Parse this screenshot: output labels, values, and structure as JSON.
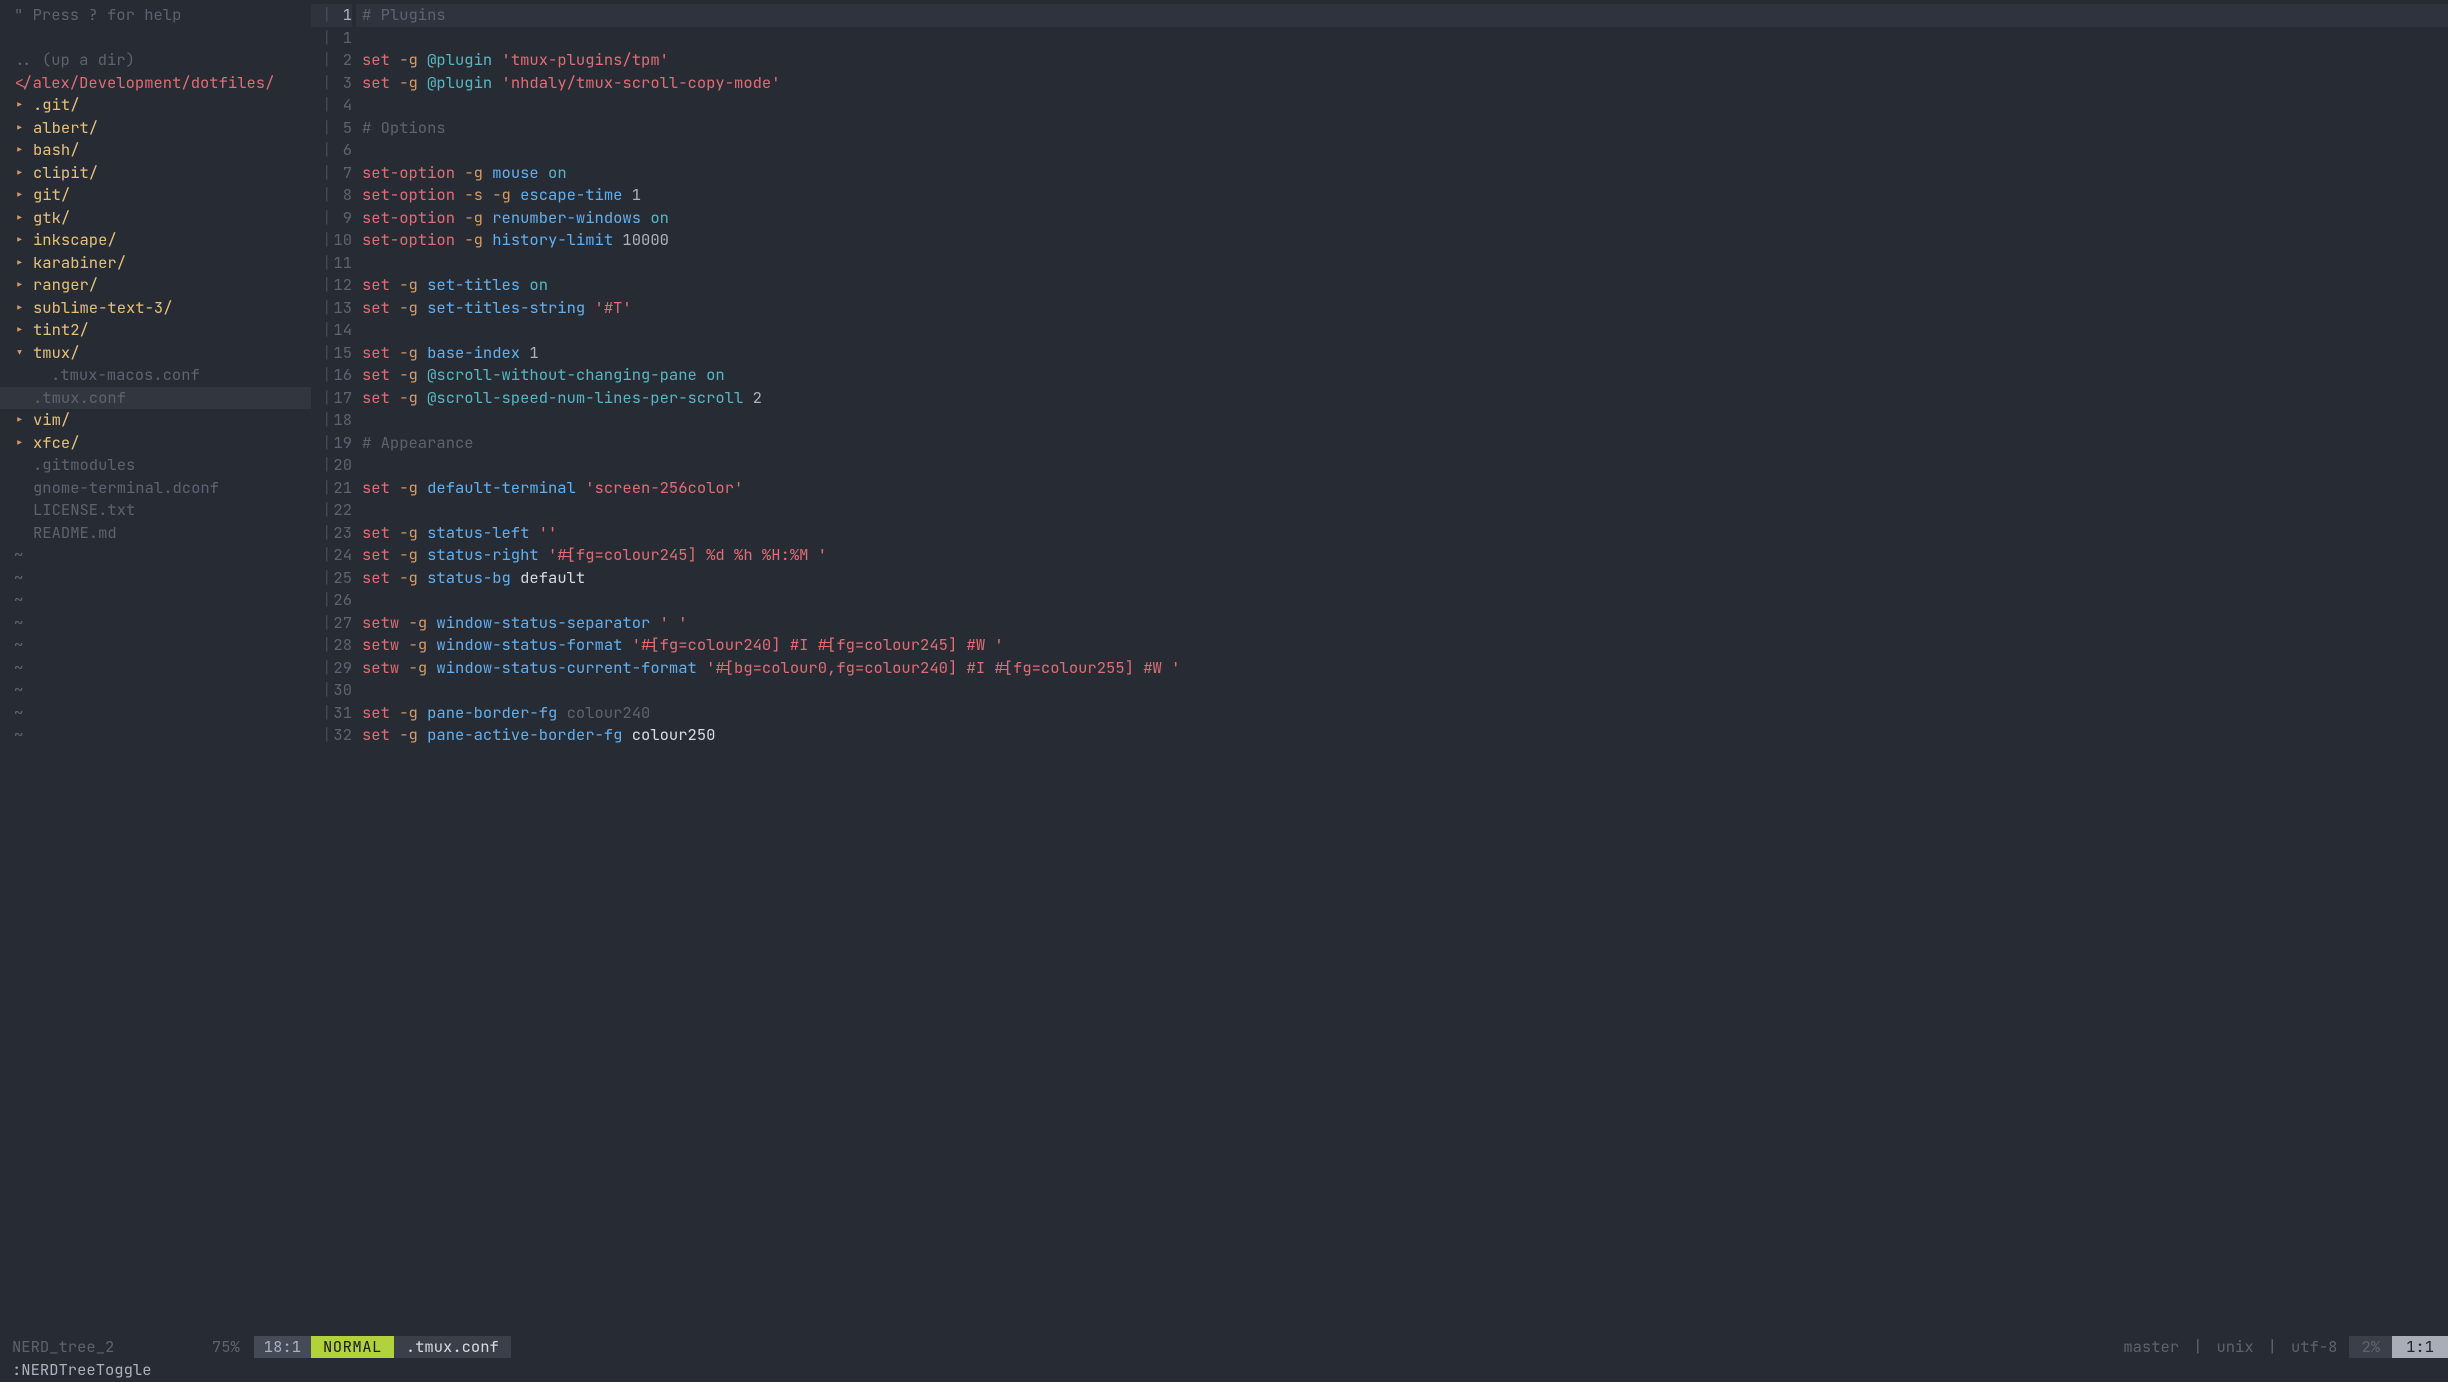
{
  "tree": {
    "help": "\" Press ? for help",
    "updir": ".. (up a dir)",
    "path": "</alex/Development/dotfiles/",
    "entries": [
      {
        "name": ".git/",
        "kind": "dir",
        "expanded": false,
        "depth": 0,
        "selected": false
      },
      {
        "name": "albert/",
        "kind": "dir",
        "expanded": false,
        "depth": 0,
        "selected": false
      },
      {
        "name": "bash/",
        "kind": "dir",
        "expanded": false,
        "depth": 0,
        "selected": false
      },
      {
        "name": "clipit/",
        "kind": "dir",
        "expanded": false,
        "depth": 0,
        "selected": false
      },
      {
        "name": "git/",
        "kind": "dir",
        "expanded": false,
        "depth": 0,
        "selected": false
      },
      {
        "name": "gtk/",
        "kind": "dir",
        "expanded": false,
        "depth": 0,
        "selected": false
      },
      {
        "name": "inkscape/",
        "kind": "dir",
        "expanded": false,
        "depth": 0,
        "selected": false
      },
      {
        "name": "karabiner/",
        "kind": "dir",
        "expanded": false,
        "depth": 0,
        "selected": false
      },
      {
        "name": "ranger/",
        "kind": "dir",
        "expanded": false,
        "depth": 0,
        "selected": false
      },
      {
        "name": "sublime-text-3/",
        "kind": "dir",
        "expanded": false,
        "depth": 0,
        "selected": false
      },
      {
        "name": "tint2/",
        "kind": "dir",
        "expanded": false,
        "depth": 0,
        "selected": false
      },
      {
        "name": "tmux/",
        "kind": "dir",
        "expanded": true,
        "depth": 0,
        "selected": false
      },
      {
        "name": ".tmux-macos.conf",
        "kind": "file",
        "expanded": false,
        "depth": 1,
        "selected": false
      },
      {
        "name": ".tmux.conf",
        "kind": "file",
        "expanded": false,
        "depth": 1,
        "selected": true
      },
      {
        "name": "vim/",
        "kind": "dir",
        "expanded": false,
        "depth": 0,
        "selected": false
      },
      {
        "name": "xfce/",
        "kind": "dir",
        "expanded": false,
        "depth": 0,
        "selected": false
      },
      {
        "name": ".gitmodules",
        "kind": "file",
        "expanded": false,
        "depth": 0,
        "selected": false
      },
      {
        "name": "gnome-terminal.dconf",
        "kind": "file",
        "expanded": false,
        "depth": 0,
        "selected": false
      },
      {
        "name": "LICENSE.txt",
        "kind": "file",
        "expanded": false,
        "depth": 0,
        "selected": false
      },
      {
        "name": "README.md",
        "kind": "file",
        "expanded": false,
        "depth": 0,
        "selected": false
      }
    ],
    "tilde": "~"
  },
  "editor": {
    "current_line_display": "1",
    "lines": [
      {
        "n": 0,
        "tokens": [
          {
            "t": "# Plugins",
            "c": "c-comment"
          }
        ]
      },
      {
        "n": 1,
        "tokens": []
      },
      {
        "n": 2,
        "tokens": [
          {
            "t": "set ",
            "c": "c-kw"
          },
          {
            "t": "-g ",
            "c": "c-flag"
          },
          {
            "t": "@plugin ",
            "c": "c-cyan"
          },
          {
            "t": "'tmux-plugins/tpm'",
            "c": "c-str"
          }
        ]
      },
      {
        "n": 3,
        "tokens": [
          {
            "t": "set ",
            "c": "c-kw"
          },
          {
            "t": "-g ",
            "c": "c-flag"
          },
          {
            "t": "@plugin ",
            "c": "c-cyan"
          },
          {
            "t": "'nhdaly/tmux-scroll-copy-mode'",
            "c": "c-str"
          }
        ]
      },
      {
        "n": 4,
        "tokens": []
      },
      {
        "n": 5,
        "tokens": [
          {
            "t": "# Options",
            "c": "c-comment"
          }
        ]
      },
      {
        "n": 6,
        "tokens": []
      },
      {
        "n": 7,
        "tokens": [
          {
            "t": "set-option ",
            "c": "c-kw"
          },
          {
            "t": "-g ",
            "c": "c-flag"
          },
          {
            "t": "mouse ",
            "c": "c-opt"
          },
          {
            "t": "on",
            "c": "c-on"
          }
        ]
      },
      {
        "n": 8,
        "tokens": [
          {
            "t": "set-option ",
            "c": "c-kw"
          },
          {
            "t": "-s -g ",
            "c": "c-flag"
          },
          {
            "t": "escape-time ",
            "c": "c-opt"
          },
          {
            "t": "1",
            "c": "c-lit"
          }
        ]
      },
      {
        "n": 9,
        "tokens": [
          {
            "t": "set-option ",
            "c": "c-kw"
          },
          {
            "t": "-g ",
            "c": "c-flag"
          },
          {
            "t": "renumber-windows ",
            "c": "c-opt"
          },
          {
            "t": "on",
            "c": "c-on"
          }
        ]
      },
      {
        "n": 10,
        "tokens": [
          {
            "t": "set-option ",
            "c": "c-kw"
          },
          {
            "t": "-g ",
            "c": "c-flag"
          },
          {
            "t": "history-limit ",
            "c": "c-opt"
          },
          {
            "t": "10000",
            "c": "c-lit"
          }
        ]
      },
      {
        "n": 11,
        "tokens": []
      },
      {
        "n": 12,
        "tokens": [
          {
            "t": "set ",
            "c": "c-kw"
          },
          {
            "t": "-g ",
            "c": "c-flag"
          },
          {
            "t": "set-titles ",
            "c": "c-opt"
          },
          {
            "t": "on",
            "c": "c-on"
          }
        ]
      },
      {
        "n": 13,
        "tokens": [
          {
            "t": "set ",
            "c": "c-kw"
          },
          {
            "t": "-g ",
            "c": "c-flag"
          },
          {
            "t": "set-titles-string ",
            "c": "c-opt"
          },
          {
            "t": "'#T'",
            "c": "c-str"
          }
        ]
      },
      {
        "n": 14,
        "tokens": []
      },
      {
        "n": 15,
        "tokens": [
          {
            "t": "set ",
            "c": "c-kw"
          },
          {
            "t": "-g ",
            "c": "c-flag"
          },
          {
            "t": "base-index ",
            "c": "c-opt"
          },
          {
            "t": "1",
            "c": "c-lit"
          }
        ]
      },
      {
        "n": 16,
        "tokens": [
          {
            "t": "set ",
            "c": "c-kw"
          },
          {
            "t": "-g ",
            "c": "c-flag"
          },
          {
            "t": "@scroll-without-changing-pane ",
            "c": "c-cyan"
          },
          {
            "t": "on",
            "c": "c-on"
          }
        ]
      },
      {
        "n": 17,
        "tokens": [
          {
            "t": "set ",
            "c": "c-kw"
          },
          {
            "t": "-g ",
            "c": "c-flag"
          },
          {
            "t": "@scroll-speed-num-lines-per-scroll ",
            "c": "c-cyan"
          },
          {
            "t": "2",
            "c": "c-lit"
          }
        ]
      },
      {
        "n": 18,
        "tokens": []
      },
      {
        "n": 19,
        "tokens": [
          {
            "t": "# Appearance",
            "c": "c-comment"
          }
        ]
      },
      {
        "n": 20,
        "tokens": []
      },
      {
        "n": 21,
        "tokens": [
          {
            "t": "set ",
            "c": "c-kw"
          },
          {
            "t": "-g ",
            "c": "c-flag"
          },
          {
            "t": "default-terminal ",
            "c": "c-opt"
          },
          {
            "t": "'screen-256color'",
            "c": "c-str"
          }
        ]
      },
      {
        "n": 22,
        "tokens": []
      },
      {
        "n": 23,
        "tokens": [
          {
            "t": "set ",
            "c": "c-kw"
          },
          {
            "t": "-g ",
            "c": "c-flag"
          },
          {
            "t": "status-left ",
            "c": "c-opt"
          },
          {
            "t": "''",
            "c": "c-str"
          }
        ]
      },
      {
        "n": 24,
        "tokens": [
          {
            "t": "set ",
            "c": "c-kw"
          },
          {
            "t": "-g ",
            "c": "c-flag"
          },
          {
            "t": "status-right ",
            "c": "c-opt"
          },
          {
            "t": "'#[fg=colour245] %d %h %H:%M '",
            "c": "c-str"
          }
        ]
      },
      {
        "n": 25,
        "tokens": [
          {
            "t": "set ",
            "c": "c-kw"
          },
          {
            "t": "-g ",
            "c": "c-flag"
          },
          {
            "t": "status-bg ",
            "c": "c-opt"
          },
          {
            "t": "default",
            "c": "c-white"
          }
        ]
      },
      {
        "n": 26,
        "tokens": []
      },
      {
        "n": 27,
        "tokens": [
          {
            "t": "setw ",
            "c": "c-kw"
          },
          {
            "t": "-g ",
            "c": "c-flag"
          },
          {
            "t": "window-status-separator ",
            "c": "c-opt"
          },
          {
            "t": "' '",
            "c": "c-str"
          }
        ]
      },
      {
        "n": 28,
        "tokens": [
          {
            "t": "setw ",
            "c": "c-kw"
          },
          {
            "t": "-g ",
            "c": "c-flag"
          },
          {
            "t": "window-status-format ",
            "c": "c-opt"
          },
          {
            "t": "'#[fg=colour240] #I #[fg=colour245] #W '",
            "c": "c-str"
          }
        ]
      },
      {
        "n": 29,
        "tokens": [
          {
            "t": "setw ",
            "c": "c-kw"
          },
          {
            "t": "-g ",
            "c": "c-flag"
          },
          {
            "t": "window-status-current-format ",
            "c": "c-opt"
          },
          {
            "t": "'#[bg=colour0,fg=colour240] #I #[fg=colour255] #W '",
            "c": "c-str"
          }
        ]
      },
      {
        "n": 30,
        "tokens": []
      },
      {
        "n": 31,
        "tokens": [
          {
            "t": "set ",
            "c": "c-kw"
          },
          {
            "t": "-g ",
            "c": "c-flag"
          },
          {
            "t": "pane-border-fg ",
            "c": "c-opt"
          },
          {
            "t": "colour240",
            "c": "c-dim"
          }
        ]
      },
      {
        "n": 32,
        "tokens": [
          {
            "t": "set ",
            "c": "c-kw"
          },
          {
            "t": "-g ",
            "c": "c-flag"
          },
          {
            "t": "pane-active-border-fg ",
            "c": "c-opt"
          },
          {
            "t": "colour250",
            "c": "c-white"
          }
        ]
      }
    ]
  },
  "status": {
    "tree_name": "NERD_tree_2",
    "tree_pct": "75%",
    "tree_pos": "18:1",
    "mode": "NORMAL",
    "filename": ".tmux.conf",
    "branch": "master",
    "sep": "|",
    "fileformat": "unix",
    "encoding": "utf-8",
    "ed_pct": "2%",
    "ed_pos": "1:1"
  },
  "cmdline": ":NERDTreeToggle"
}
